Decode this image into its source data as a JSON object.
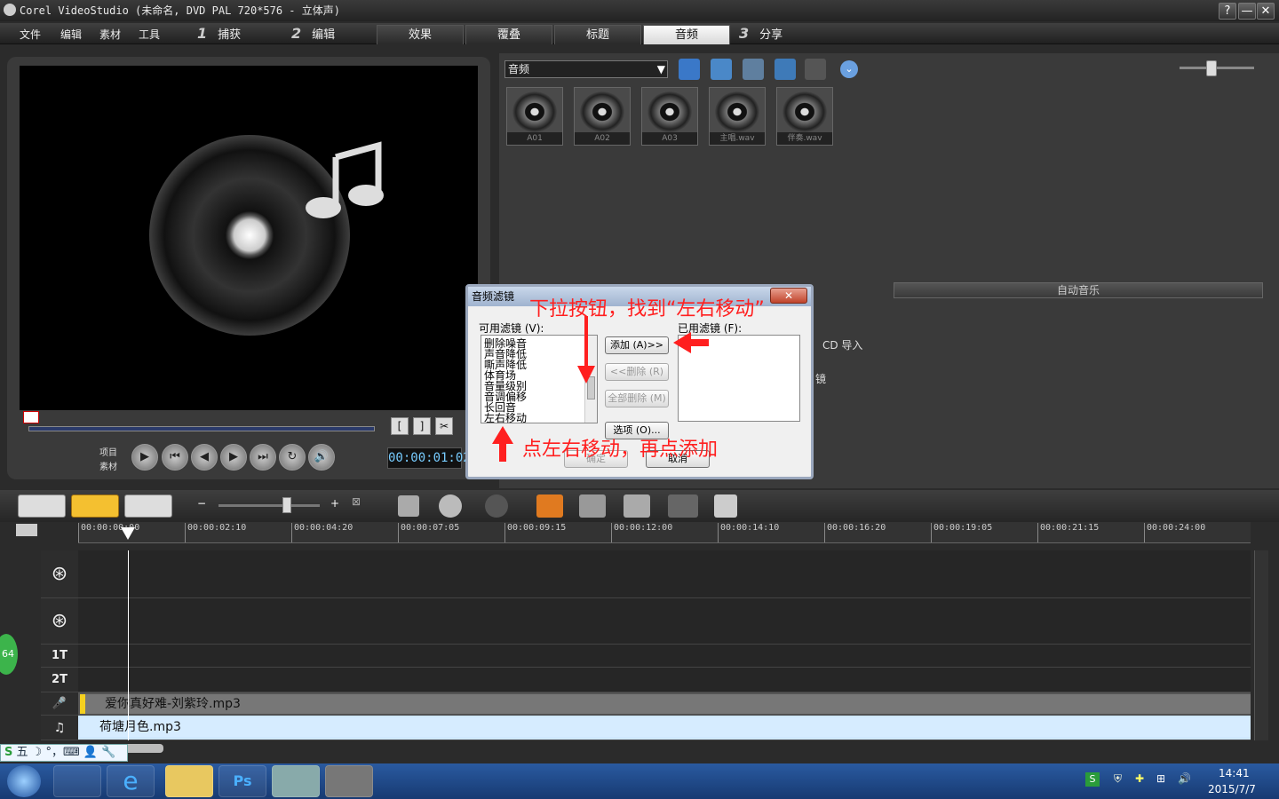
{
  "window": {
    "title": "Corel VideoStudio (未命名, DVD PAL 720*576 - 立体声)",
    "help": "?",
    "minimize": "—",
    "close": "✕"
  },
  "menu": [
    "文件",
    "编辑",
    "素材",
    "工具"
  ],
  "steps": [
    {
      "num": "1",
      "label": "捕获"
    },
    {
      "num": "2",
      "label": "编辑"
    },
    {
      "num": "3",
      "label": "分享"
    }
  ],
  "tabs": [
    "效果",
    "覆叠",
    "标题",
    "音频"
  ],
  "player": {
    "mode_project": "项目",
    "mode_clip": "素材",
    "timecode": "00:00:01:02",
    "mark_in": "[",
    "mark_out": "]"
  },
  "library": {
    "category": "音频",
    "auto_music": "自动音乐",
    "cd_import": "CD 导入",
    "filter_partial": "镜",
    "thumbs": [
      "A01",
      "A02",
      "A03",
      "主唱.wav",
      "伴奏.wav"
    ]
  },
  "dialog": {
    "title": "音频滤镜",
    "close": "✕",
    "available_label": "可用滤镜 (V):",
    "used_label": "已用滤镜 (F):",
    "filters": [
      "删除噪音",
      "声音降低",
      "嘶声降低",
      "体育场",
      "音量级别",
      "音调偏移",
      "长回音",
      "左右移动"
    ],
    "btn_add": "添加 (A)>>",
    "btn_remove": "<<删除 (R)",
    "btn_remove_all": "全部删除 (M)",
    "btn_options": "选项 (O)...",
    "btn_ok": "确定",
    "btn_cancel": "取消"
  },
  "annotations": {
    "top": "下拉按钮，找到“左右移动”",
    "bottom": "点左右移动，再点添加"
  },
  "timeline": {
    "ticks": [
      "00:00:00:00",
      "00:00:02:10",
      "00:00:04:20",
      "00:00:07:05",
      "00:00:09:15",
      "00:00:12:00",
      "00:00:14:10",
      "00:00:16:20",
      "00:00:19:05",
      "00:00:21:15",
      "00:00:24:00"
    ],
    "title_track_1": "1T",
    "title_track_2": "2T",
    "voice_clip": "爱你真好难-刘紫玲.mp3",
    "music_clip": "荷塘月色.mp3"
  },
  "ime": {
    "mode": "五"
  },
  "badge": "64",
  "clock": {
    "time": "14:41",
    "date": "2015/7/7"
  }
}
